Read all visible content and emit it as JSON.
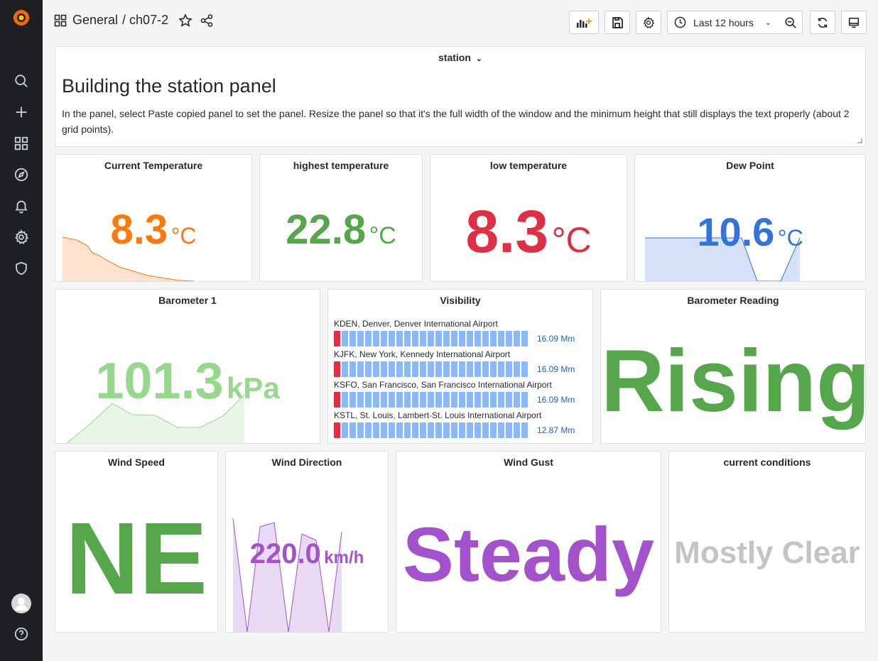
{
  "topbar": {
    "folder": "General",
    "dashboard": "/ ch07-2",
    "time_range": "Last 12 hours"
  },
  "variable": {
    "label": "station"
  },
  "text_panel": {
    "heading": "Building the station panel",
    "body": "In the panel, select Paste copied panel to set the panel. Resize the panel so that it's the full width of the window and the minimum height that still displays the text properly (about 2 grid points)."
  },
  "panels": {
    "current_temp": {
      "title": "Current Temperature",
      "value": "8.3",
      "unit": "°C",
      "color": "#ff780a"
    },
    "high_temp": {
      "title": "highest temperature",
      "value": "22.8",
      "unit": "°C",
      "color": "#56a64b"
    },
    "low_temp": {
      "title": "low temperature",
      "value": "8.3",
      "unit": "°C",
      "color": "#e02f44"
    },
    "dew_point": {
      "title": "Dew Point",
      "value": "10.6",
      "unit": "°C",
      "color": "#3274d9"
    },
    "barometer1": {
      "title": "Barometer 1",
      "value": "101.3",
      "unit": "kPa",
      "color": "#96d98d"
    },
    "visibility": {
      "title": "Visibility",
      "rows": [
        {
          "label": "KDEN, Denver, Denver International Airport",
          "value": "16.09 Mm"
        },
        {
          "label": "KJFK, New York, Kennedy International Airport",
          "value": "16.09 Mm"
        },
        {
          "label": "KSFO, San Francisco, San Francisco International Airport",
          "value": "16.09 Mm"
        },
        {
          "label": "KSTL, St. Louis, Lambert-St. Louis International Airport",
          "value": "12.87 Mm"
        }
      ]
    },
    "barometer_reading": {
      "title": "Barometer Reading",
      "value": "Rising",
      "color": "#56a64b"
    },
    "wind_speed": {
      "title": "Wind Speed",
      "value": "NE",
      "color": "#56a64b"
    },
    "wind_direction": {
      "title": "Wind Direction",
      "value": "220.0",
      "unit": "km/h",
      "color": "#a352cc"
    },
    "wind_gust": {
      "title": "Wind Gust",
      "value": "Steady",
      "color": "#a352cc"
    },
    "current_conditions": {
      "title": "current conditions",
      "value": "Mostly Clear",
      "color": "#c4c4c4"
    }
  }
}
